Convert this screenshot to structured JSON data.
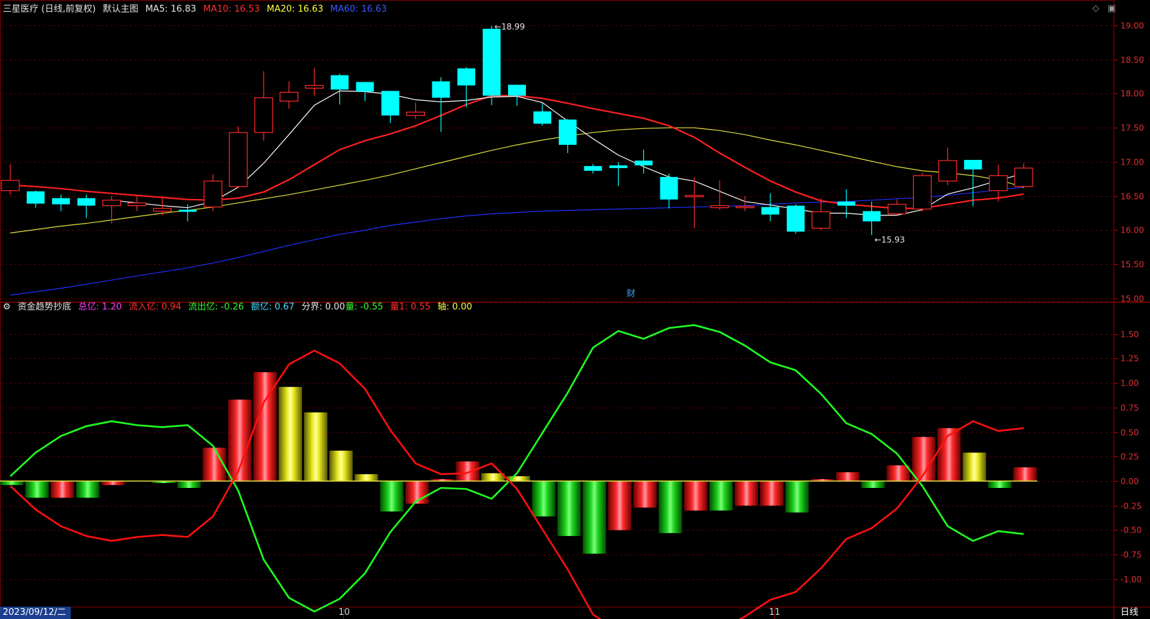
{
  "main_header": {
    "stock": "三星医疗 (日线,前复权)",
    "template": "默认主图",
    "ma5": "MA5: 16.83",
    "ma10": "MA10: 16.53",
    "ma20": "MA20: 16.63",
    "ma60": "MA60: 16.63"
  },
  "sub_header": {
    "indicator": "资金趋势抄底",
    "total": "总亿: 1.20",
    "inflow": "流入亿: 0.94",
    "outflow": "流出亿: -0.26",
    "amount": "额亿: 0.67",
    "boundary": "分界: 0.00",
    "liang": "量: -0.55",
    "liang1": "量1: 0.55",
    "axis": "轴: 0.00"
  },
  "footer": {
    "date": "2023/09/12/二",
    "month_oct": "10",
    "month_nov": "11",
    "period": "日线"
  },
  "colors": {
    "up": "#ff2a2a",
    "down": "#00ffff",
    "ma5": "#ffffff",
    "ma10": "#ff2020",
    "ma20": "#e0e040",
    "ma60": "#2030ff",
    "green_line": "#20ff20",
    "red_line": "#ff1010"
  },
  "chart_data": [
    {
      "type": "candlestick",
      "ylim": [
        14.95,
        19.15
      ],
      "yticks": [
        "15.00",
        "15.50",
        "16.00",
        "16.50",
        "17.00",
        "17.50",
        "18.00",
        "18.50",
        "19.00"
      ],
      "annotations": {
        "high_label": "18.99",
        "low_label": "15.93",
        "event_marker": "财"
      },
      "candles": [
        {
          "o": 16.58,
          "c": 16.73,
          "h": 16.97,
          "l": 16.52
        },
        {
          "o": 16.57,
          "c": 16.39,
          "h": 16.58,
          "l": 16.33
        },
        {
          "o": 16.47,
          "c": 16.38,
          "h": 16.52,
          "l": 16.28
        },
        {
          "o": 16.47,
          "c": 16.36,
          "h": 16.52,
          "l": 16.18
        },
        {
          "o": 16.36,
          "c": 16.44,
          "h": 16.5,
          "l": 16.1
        },
        {
          "o": 16.36,
          "c": 16.4,
          "h": 16.5,
          "l": 16.28
        },
        {
          "o": 16.28,
          "c": 16.32,
          "h": 16.5,
          "l": 16.22
        },
        {
          "o": 16.3,
          "c": 16.27,
          "h": 16.38,
          "l": 16.13
        },
        {
          "o": 16.34,
          "c": 16.72,
          "h": 16.82,
          "l": 16.28
        },
        {
          "o": 16.64,
          "c": 17.43,
          "h": 17.52,
          "l": 16.62
        },
        {
          "o": 17.43,
          "c": 17.94,
          "h": 18.33,
          "l": 17.31
        },
        {
          "o": 17.89,
          "c": 18.02,
          "h": 18.18,
          "l": 17.78
        },
        {
          "o": 18.08,
          "c": 18.12,
          "h": 18.38,
          "l": 17.97
        },
        {
          "o": 18.27,
          "c": 18.06,
          "h": 18.29,
          "l": 17.84
        },
        {
          "o": 18.17,
          "c": 18.03,
          "h": 18.17,
          "l": 17.89
        },
        {
          "o": 18.04,
          "c": 17.68,
          "h": 18.04,
          "l": 17.57
        },
        {
          "o": 17.68,
          "c": 17.73,
          "h": 17.87,
          "l": 17.63
        },
        {
          "o": 18.18,
          "c": 17.94,
          "h": 18.24,
          "l": 17.44
        },
        {
          "o": 18.37,
          "c": 18.12,
          "h": 18.39,
          "l": 17.8
        },
        {
          "o": 18.95,
          "c": 17.97,
          "h": 18.99,
          "l": 17.83
        },
        {
          "o": 18.13,
          "c": 17.97,
          "h": 18.13,
          "l": 17.82
        },
        {
          "o": 17.74,
          "c": 17.56,
          "h": 17.86,
          "l": 17.53
        },
        {
          "o": 17.62,
          "c": 17.25,
          "h": 17.63,
          "l": 17.13
        },
        {
          "o": 16.94,
          "c": 16.87,
          "h": 16.97,
          "l": 16.83
        },
        {
          "o": 16.95,
          "c": 16.91,
          "h": 17.0,
          "l": 16.65
        },
        {
          "o": 17.02,
          "c": 16.95,
          "h": 17.18,
          "l": 16.83
        },
        {
          "o": 16.78,
          "c": 16.45,
          "h": 16.83,
          "l": 16.32
        },
        {
          "o": 16.49,
          "c": 16.51,
          "h": 16.77,
          "l": 16.03
        },
        {
          "o": 16.33,
          "c": 16.36,
          "h": 16.73,
          "l": 16.3
        },
        {
          "o": 16.33,
          "c": 16.35,
          "h": 16.5,
          "l": 16.28
        },
        {
          "o": 16.34,
          "c": 16.23,
          "h": 16.54,
          "l": 16.13
        },
        {
          "o": 16.36,
          "c": 15.98,
          "h": 16.38,
          "l": 15.95
        },
        {
          "o": 16.03,
          "c": 16.27,
          "h": 16.47,
          "l": 16.0
        },
        {
          "o": 16.42,
          "c": 16.36,
          "h": 16.6,
          "l": 16.18
        },
        {
          "o": 16.28,
          "c": 16.13,
          "h": 16.42,
          "l": 15.93
        },
        {
          "o": 16.24,
          "c": 16.38,
          "h": 16.45,
          "l": 16.22
        },
        {
          "o": 16.31,
          "c": 16.8,
          "h": 16.84,
          "l": 16.27
        },
        {
          "o": 16.72,
          "c": 17.02,
          "h": 17.21,
          "l": 16.66
        },
        {
          "o": 17.03,
          "c": 16.89,
          "h": 17.03,
          "l": 16.35
        },
        {
          "o": 16.58,
          "c": 16.8,
          "h": 16.96,
          "l": 16.42
        },
        {
          "o": 16.64,
          "c": 16.91,
          "h": 16.98,
          "l": 16.61
        }
      ],
      "ma5": [
        null,
        null,
        null,
        null,
        16.44,
        16.4,
        16.36,
        16.33,
        16.42,
        16.63,
        16.98,
        17.4,
        17.83,
        18.04,
        18.03,
        17.99,
        17.91,
        17.88,
        17.9,
        17.95,
        17.96,
        17.87,
        17.6,
        17.34,
        17.1,
        16.93,
        16.78,
        16.72,
        16.57,
        16.42,
        16.37,
        16.31,
        16.25,
        16.25,
        16.22,
        16.22,
        16.3,
        16.53,
        16.62,
        16.73,
        16.83
      ],
      "ma10": [
        16.66,
        16.64,
        16.61,
        16.57,
        16.54,
        16.51,
        16.48,
        16.45,
        16.44,
        16.47,
        16.56,
        16.74,
        16.96,
        17.18,
        17.31,
        17.41,
        17.53,
        17.68,
        17.84,
        17.97,
        17.97,
        17.93,
        17.86,
        17.78,
        17.71,
        17.64,
        17.53,
        17.36,
        17.13,
        16.92,
        16.72,
        16.56,
        16.43,
        16.38,
        16.35,
        16.32,
        16.32,
        16.38,
        16.44,
        16.47,
        16.53
      ],
      "ma20": [
        15.96,
        16.01,
        16.06,
        16.1,
        16.15,
        16.2,
        16.25,
        16.29,
        16.34,
        16.4,
        16.46,
        16.52,
        16.59,
        16.66,
        16.73,
        16.81,
        16.9,
        16.99,
        17.08,
        17.17,
        17.25,
        17.32,
        17.38,
        17.43,
        17.47,
        17.49,
        17.5,
        17.5,
        17.46,
        17.4,
        17.32,
        17.25,
        17.17,
        17.09,
        17.01,
        16.93,
        16.87,
        16.84,
        16.8,
        16.74,
        16.63
      ],
      "ma60": [
        15.05,
        15.1,
        15.15,
        15.21,
        15.27,
        15.33,
        15.39,
        15.45,
        15.52,
        15.6,
        15.69,
        15.78,
        15.86,
        15.94,
        16.0,
        16.07,
        16.12,
        16.17,
        16.21,
        16.24,
        16.26,
        16.28,
        16.29,
        16.3,
        16.31,
        16.32,
        16.33,
        16.34,
        16.35,
        16.36,
        16.38,
        16.4,
        16.41,
        16.42,
        16.44,
        16.46,
        16.48,
        16.51,
        16.55,
        16.59,
        16.63
      ]
    },
    {
      "type": "bar",
      "ylim": [
        -1.28,
        1.7
      ],
      "yticks": [
        "-1.00",
        "-0.75",
        "-0.50",
        "-0.25",
        "0.00",
        "0.25",
        "0.50",
        "0.75",
        "1.00",
        "1.25",
        "1.50"
      ],
      "series": [
        {
          "name": "总亿",
          "kind": "bar",
          "values": [
            -0.04,
            -0.17,
            -0.17,
            -0.17,
            -0.04,
            0.0,
            -0.02,
            -0.07,
            0.34,
            0.83,
            1.11,
            0.96,
            0.7,
            0.31,
            0.07,
            -0.31,
            -0.23,
            0.02,
            0.2,
            0.08,
            0.05,
            -0.36,
            -0.56,
            -0.74,
            -0.5,
            -0.27,
            -0.53,
            -0.3,
            -0.3,
            -0.25,
            -0.25,
            -0.32,
            0.02,
            0.09,
            -0.07,
            0.16,
            0.45,
            0.54,
            0.29,
            -0.07,
            0.14
          ],
          "colors": [
            "g",
            "g",
            "r",
            "g",
            "r",
            "g",
            "g",
            "g",
            "r",
            "r",
            "r",
            "y",
            "y",
            "y",
            "y",
            "g",
            "r",
            "r",
            "r",
            "y",
            "y",
            "g",
            "g",
            "g",
            "r",
            "r",
            "g",
            "r",
            "g",
            "r",
            "r",
            "g",
            "r",
            "r",
            "g",
            "r",
            "r",
            "r",
            "y",
            "g",
            "r"
          ]
        },
        {
          "name": "量",
          "kind": "line",
          "values": [
            0.05,
            0.29,
            0.46,
            0.56,
            0.61,
            0.57,
            0.55,
            0.57,
            0.36,
            -0.1,
            -0.8,
            -1.19,
            -1.33,
            -1.2,
            -0.94,
            -0.52,
            -0.21,
            -0.07,
            -0.08,
            -0.18,
            0.08,
            0.49,
            0.9,
            1.36,
            1.53,
            1.45,
            1.56,
            1.59,
            1.52,
            1.38,
            1.21,
            1.13,
            0.89,
            0.59,
            0.48,
            0.28,
            -0.05,
            -0.46,
            -0.61,
            -0.51,
            -0.54
          ]
        },
        {
          "name": "量1",
          "kind": "line",
          "values": [
            -0.05,
            -0.29,
            -0.46,
            -0.56,
            -0.61,
            -0.57,
            -0.55,
            -0.57,
            -0.36,
            0.1,
            0.8,
            1.19,
            1.33,
            1.2,
            0.94,
            0.52,
            0.18,
            0.07,
            0.08,
            0.18,
            -0.08,
            -0.49,
            -0.9,
            -1.36,
            -1.53,
            -1.45,
            -1.56,
            -1.59,
            -1.52,
            -1.38,
            -1.21,
            -1.13,
            -0.89,
            -0.59,
            -0.48,
            -0.28,
            0.05,
            0.46,
            0.61,
            0.51,
            0.54
          ]
        }
      ]
    }
  ]
}
